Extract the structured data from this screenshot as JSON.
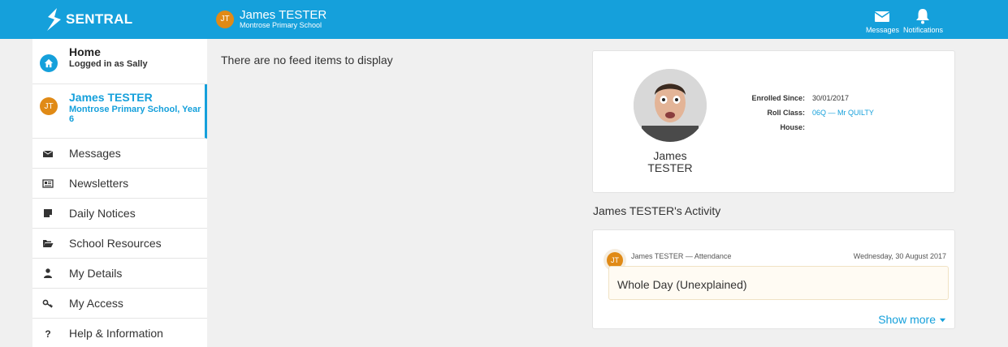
{
  "app": {
    "brand": "SENTRAL"
  },
  "header": {
    "user_initials": "JT",
    "user_name": "James TESTER",
    "school": "Montrose Primary School",
    "actions": [
      {
        "label": "Messages",
        "icon": "envelope-icon"
      },
      {
        "label": "Notifications",
        "icon": "bell-icon"
      }
    ]
  },
  "sidebar": {
    "home": {
      "title": "Home",
      "subtitle": "Logged in as Sally"
    },
    "student": {
      "initials": "JT",
      "name": "James TESTER",
      "detail": "Montrose Primary School, Year 6"
    },
    "items": [
      {
        "label": "Messages",
        "icon": "envelope-icon"
      },
      {
        "label": "Newsletters",
        "icon": "newspaper-icon"
      },
      {
        "label": "Daily Notices",
        "icon": "sticky-note-icon"
      },
      {
        "label": "School Resources",
        "icon": "folder-open-icon"
      },
      {
        "label": "My Details",
        "icon": "user-icon"
      },
      {
        "label": "My Access",
        "icon": "key-icon"
      },
      {
        "label": "Help & Information",
        "icon": "question-icon"
      }
    ]
  },
  "feed": {
    "empty_message": "There are no feed items to display"
  },
  "profile": {
    "first_name": "James",
    "last_name": "TESTER",
    "enrolled_label": "Enrolled Since:",
    "enrolled_value": "30/01/2017",
    "roll_label": "Roll Class:",
    "roll_value": "06Q — Mr QUILTY",
    "house_label": "House:",
    "house_value": ""
  },
  "activity": {
    "title": "James TESTER's Activity",
    "initials": "JT",
    "meta": "James TESTER — Attendance",
    "date": "Wednesday, 30 August 2017",
    "content": "Whole Day (Unexplained)",
    "show_more": "Show more"
  },
  "colors": {
    "accent": "#15a0db",
    "avatar": "#e08a16"
  }
}
